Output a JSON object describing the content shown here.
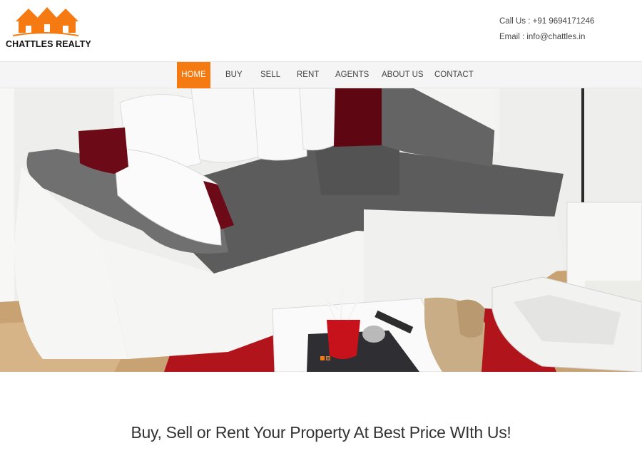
{
  "brand": {
    "name": "CHATTLES REALTY",
    "accent_color": "#f47a11"
  },
  "contact": {
    "phone": "Call Us : +91 9694171246",
    "email": "Email : info@chattles.in"
  },
  "nav": {
    "items": [
      {
        "label": "HOME",
        "active": true
      },
      {
        "label": "BUY"
      },
      {
        "label": "SELL"
      },
      {
        "label": "RENT"
      },
      {
        "label": "AGENTS"
      },
      {
        "label": "ABOUT US"
      },
      {
        "label": "CONTACT"
      }
    ]
  },
  "hero": {
    "slide_indicators": 2,
    "active_slide": 0
  },
  "tagline": "Buy, Sell or Rent Your Property At Best Price WIth Us!"
}
